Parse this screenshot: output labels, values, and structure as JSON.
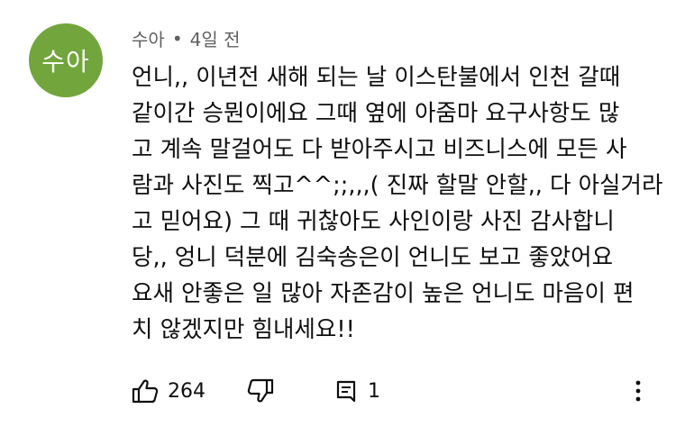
{
  "author": {
    "name": "수아",
    "avatar_text": "수아",
    "avatar_color": "#72a53c"
  },
  "meta": {
    "separator": "•",
    "time": "4일 전"
  },
  "comment_lines": [
    "언니,, 이년전 새해 되는 날 이스탄불에서 인천 갈때",
    "같이간 승뭔이에요 그때 옆에 아줌마 요구사항도 많",
    "고 계속 말걸어도 다 받아주시고 비즈니스에 모든 사",
    "람과 사진도 찍고^^;;,,,( 진짜 할말 안할,, 다 아실거라",
    "고 믿어요) 그 때 귀찮아도 사인이랑 사진 감사합니",
    "당,,  엉니 덕분에 김숙송은이 언니도 보고 좋았어요",
    "요새 안좋은 일 많아 자존감이 높은 언니도 마음이 편",
    "치 않겠지만 힘내세요!!"
  ],
  "actions": {
    "like_count": "264",
    "reply_count": "1",
    "icons": {
      "like": "thumbs-up-icon",
      "dislike": "thumbs-down-icon",
      "reply": "reply-comment-icon",
      "more": "more-vertical-icon"
    }
  }
}
